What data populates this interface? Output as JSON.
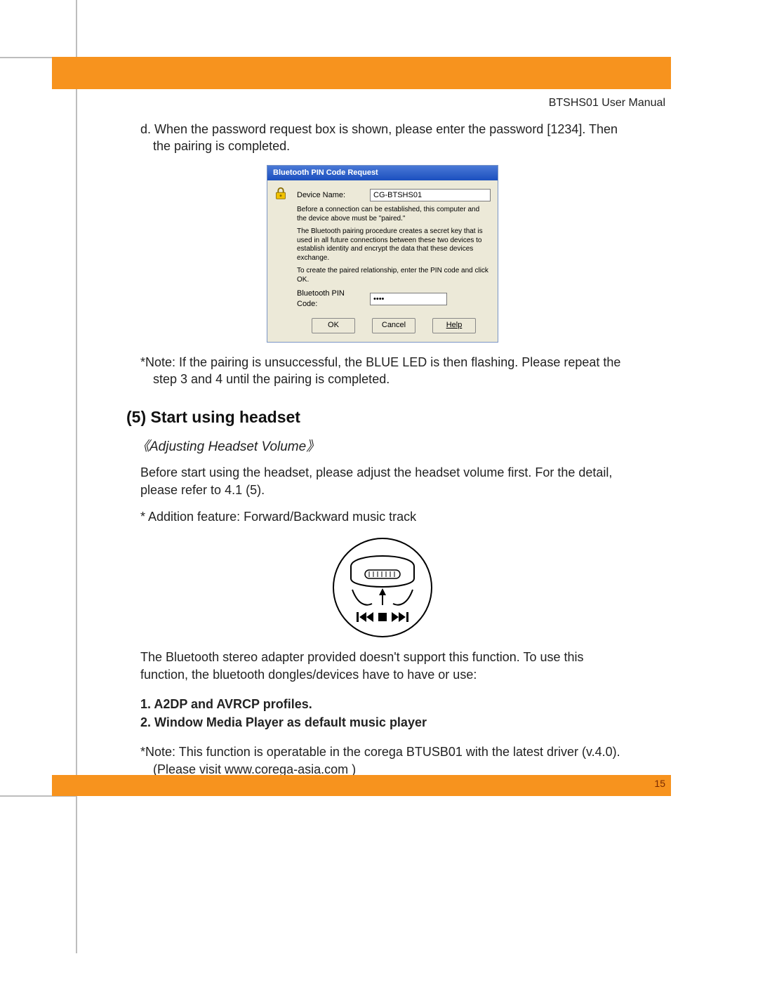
{
  "header": {
    "doc_title": "BTSHS01 User Manual"
  },
  "page_number": "15",
  "body": {
    "step_d": "d. When the password request box is shown, please enter the password [1234]. Then the pairing is completed.",
    "note_pairing": "*Note: If the pairing is unsuccessful, the BLUE LED is then flashing. Please repeat the step 3 and 4 until the pairing is completed.",
    "section5_heading": "(5) Start using headset",
    "subheading_volume": "《Adjusting Headset Volume》",
    "adjust_text": "Before start using the headset, please adjust the headset volume first. For the detail, please refer to 4.1 (5).",
    "addition_feature": "* Addition feature: Forward/Backward music track",
    "adapter_text": "The Bluetooth stereo adapter provided doesn't support this function. To use this function,  the bluetooth dongles/devices have to have or use:",
    "req1": "1. A2DP and AVRCP profiles.",
    "req2": "2. Window Media Player as default music player",
    "note_btusb": "*Note: This function is operatable in the corega BTUSB01 with the latest driver (v.4.0). (Please visit www.corega-asia.com )"
  },
  "dialog": {
    "title": "Bluetooth PIN Code Request",
    "device_name_label": "Device Name:",
    "device_name_value": "CG-BTSHS01",
    "paired_text": "Before a connection can be established, this computer and the device above must be \"paired.\"",
    "procedure_text": "The Bluetooth pairing procedure creates a secret key that is used in all future connections between these two devices to establish identity and encrypt the data that these devices exchange.",
    "enter_pin_text": "To create the paired relationship, enter the PIN code and click OK.",
    "pin_label": "Bluetooth PIN Code:",
    "pin_value": "••••",
    "ok": "OK",
    "cancel": "Cancel",
    "help": "Help"
  },
  "illustration": {
    "prev": "◂◂▮",
    "stop": "■",
    "next": "▮▸▸"
  }
}
